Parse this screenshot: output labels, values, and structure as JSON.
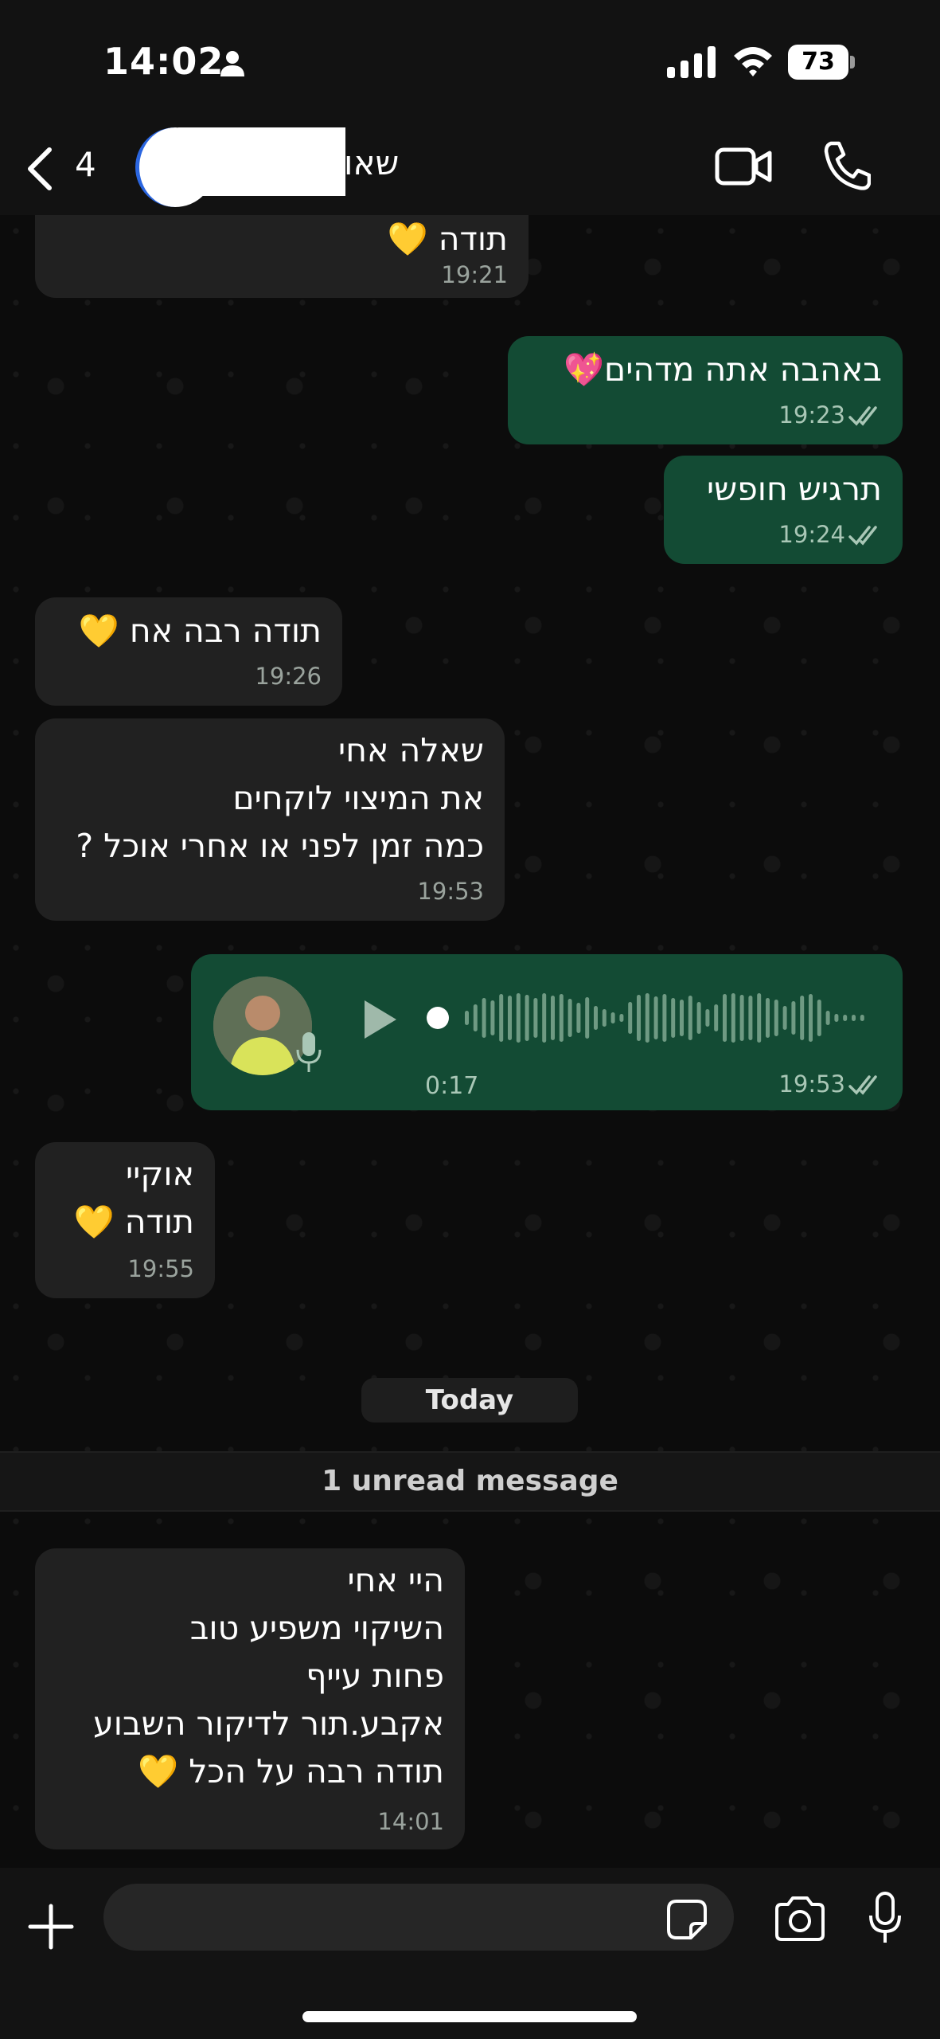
{
  "status": {
    "time": "14:02",
    "battery": "73"
  },
  "header": {
    "back_count": "4",
    "contact_name": "שאו"
  },
  "messages": [
    {
      "direction": "in",
      "text": "תודה 💛",
      "time": "19:21"
    },
    {
      "direction": "out",
      "text": "באהבה אתה מדהים💖",
      "time": "19:23",
      "status": "read"
    },
    {
      "direction": "out",
      "text": "תרגיש חופשי",
      "time": "19:24",
      "status": "read"
    },
    {
      "direction": "in",
      "text": "תודה רבה אח 💛",
      "time": "19:26"
    },
    {
      "direction": "in",
      "text": "שאלה אחי\nאת המיצוי לוקחים\nכמה זמן לפני או אחרי אוכל ?",
      "time": "19:53"
    },
    {
      "direction": "out",
      "type": "voice",
      "duration": "0:17",
      "time": "19:53",
      "status": "read"
    },
    {
      "direction": "in",
      "text": "אוקיי\nתודה 💛",
      "time": "19:55"
    },
    {
      "direction": "in",
      "text": "היי אחי\nהשיקוי משפיע טוב\nפחות עייף\nאקבע.תור לדיקור השבוע\nתודה רבה על הכל 💛",
      "time": "14:01"
    }
  ],
  "date_separator": "Today",
  "unread_banner": "1 unread message",
  "composer": {
    "placeholder": ""
  },
  "colors": {
    "outgoing_bubble": "#134b34",
    "incoming_bubble": "#212121",
    "read_ticks": "#a9c7b6"
  },
  "icons": [
    "back-chevron-icon",
    "video-call-icon",
    "phone-icon",
    "play-icon",
    "mic-icon",
    "plus-icon",
    "sticker-icon",
    "camera-icon",
    "double-check-icon",
    "signal-icon",
    "wifi-icon",
    "person-icon"
  ]
}
